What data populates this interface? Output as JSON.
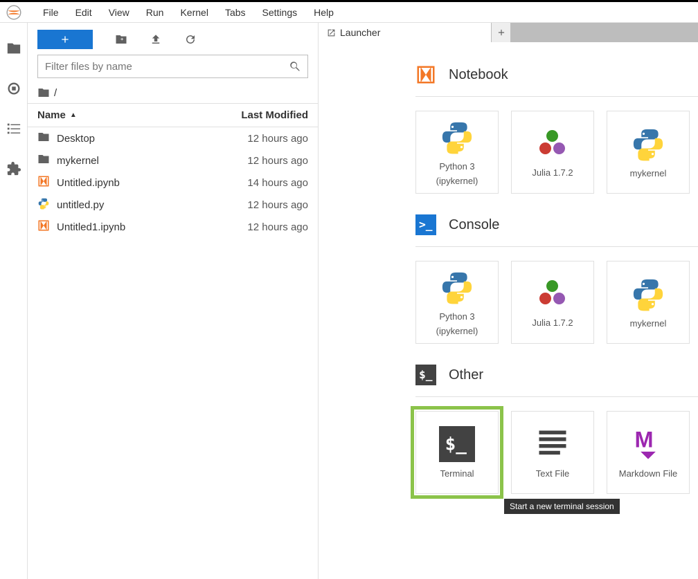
{
  "menubar": [
    "File",
    "Edit",
    "View",
    "Run",
    "Kernel",
    "Tabs",
    "Settings",
    "Help"
  ],
  "sidebar": {
    "filter_placeholder": "Filter files by name",
    "breadcrumb_root": "/",
    "columns": {
      "name": "Name",
      "modified": "Last Modified"
    },
    "files": [
      {
        "name": "Desktop",
        "modified": "12 hours ago",
        "type": "folder"
      },
      {
        "name": "mykernel",
        "modified": "12 hours ago",
        "type": "folder"
      },
      {
        "name": "Untitled.ipynb",
        "modified": "14 hours ago",
        "type": "notebook"
      },
      {
        "name": "untitled.py",
        "modified": "12 hours ago",
        "type": "python"
      },
      {
        "name": "Untitled1.ipynb",
        "modified": "12 hours ago",
        "type": "notebook"
      }
    ]
  },
  "tab": {
    "label": "Launcher"
  },
  "launcher": {
    "sections": {
      "notebook": {
        "title": "Notebook",
        "cards": [
          {
            "label": "Python 3",
            "sub": "(ipykernel)"
          },
          {
            "label": "Julia 1.7.2",
            "sub": ""
          },
          {
            "label": "mykernel",
            "sub": ""
          }
        ]
      },
      "console": {
        "title": "Console",
        "cards": [
          {
            "label": "Python 3",
            "sub": "(ipykernel)"
          },
          {
            "label": "Julia 1.7.2",
            "sub": ""
          },
          {
            "label": "mykernel",
            "sub": ""
          }
        ]
      },
      "other": {
        "title": "Other",
        "cards": [
          {
            "label": "Terminal",
            "sub": ""
          },
          {
            "label": "Text File",
            "sub": ""
          },
          {
            "label": "Markdown File",
            "sub": ""
          }
        ]
      }
    }
  },
  "tooltip": {
    "terminal": "Start a new terminal session"
  }
}
